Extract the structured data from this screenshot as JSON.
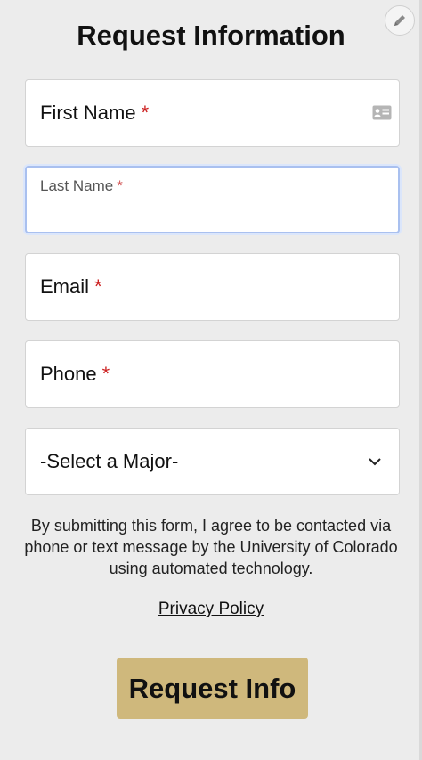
{
  "form": {
    "title": "Request Information",
    "required_marker": "*",
    "fields": {
      "first_name": {
        "label": "First Name",
        "icon": "contact-card-icon"
      },
      "last_name": {
        "label": "Last Name",
        "state": "focused"
      },
      "email": {
        "label": "Email"
      },
      "phone": {
        "label": "Phone"
      },
      "major": {
        "selected": "-Select a Major-",
        "icon": "chevron-down-icon"
      }
    },
    "consent_text": "By submitting this form, I agree to be contacted via phone or text message by the University of Colorado using automated technology.",
    "privacy_link": "Privacy Policy",
    "submit_label": "Request Info"
  },
  "toolbar": {
    "edit_icon": "pencil-icon"
  },
  "colors": {
    "background": "#ececec",
    "required": "#cc1f1f",
    "focus_border": "#a9c0ef",
    "submit_bg": "#cfb87c"
  }
}
